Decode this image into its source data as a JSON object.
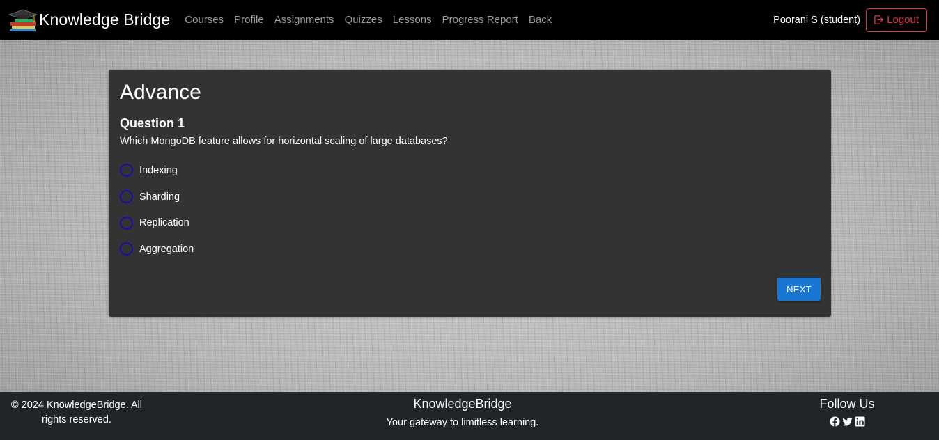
{
  "navbar": {
    "brand": "Knowledge Bridge",
    "links": [
      "Courses",
      "Profile",
      "Assignments",
      "Quizzes",
      "Lessons",
      "Progress Report",
      "Back"
    ],
    "user": "Poorani S (student)",
    "logout_label": "Logout",
    "logout_icon": "logout-icon",
    "logo_icon": "graduation-cap-books-logo"
  },
  "quiz": {
    "title": "Advance",
    "question_label": "Question 1",
    "question_text": "Which MongoDB feature allows for horizontal scaling of large databases?",
    "options": [
      "Indexing",
      "Sharding",
      "Replication",
      "Aggregation"
    ],
    "selected_option": null,
    "next_label": "NEXT"
  },
  "footer": {
    "copyright": "© 2024 KnowledgeBridge. All rights reserved.",
    "brand": "KnowledgeBridge",
    "tagline": "Your gateway to limitless learning.",
    "follow_title": "Follow Us",
    "social_icons": [
      "facebook-icon",
      "twitter-icon",
      "linkedin-icon"
    ]
  },
  "colors": {
    "navbar_bg": "#000000",
    "card_bg": "#333333",
    "footer_bg": "#212529",
    "logout": "#dc3545",
    "next_button": "#1976d2",
    "radio_border": "#1a0dab"
  }
}
